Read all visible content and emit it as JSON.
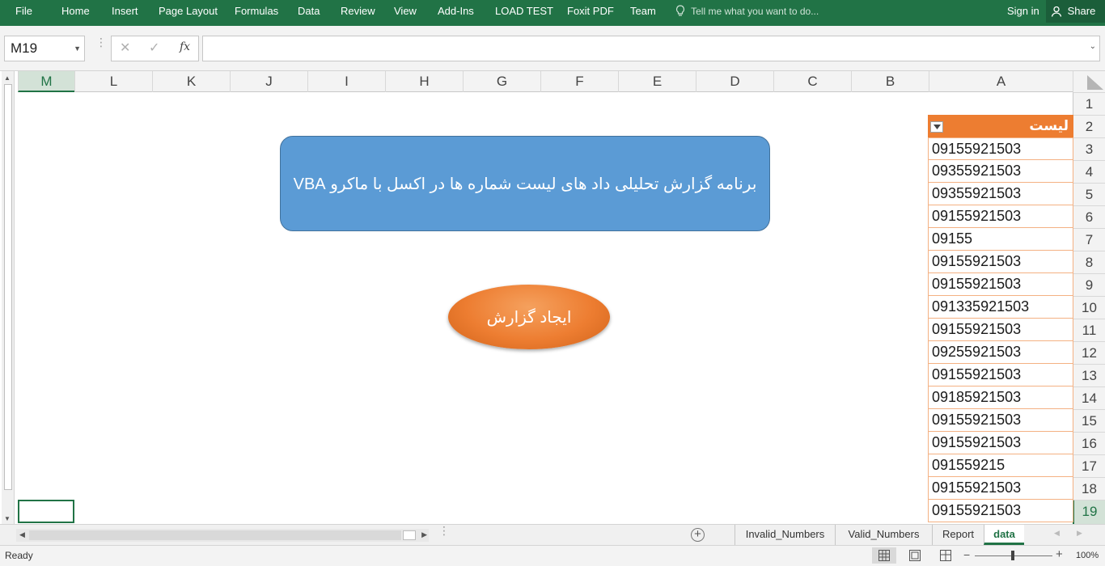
{
  "ribbon": {
    "tabs": [
      "File",
      "Home",
      "Insert",
      "Page Layout",
      "Formulas",
      "Data",
      "Review",
      "View",
      "Add-Ins",
      "LOAD TEST",
      "Foxit PDF",
      "Team"
    ],
    "tell_me": "Tell me what you want to do...",
    "sign_in": "Sign in",
    "share": "Share"
  },
  "formula_bar": {
    "name_box": "M19",
    "fx": "fx",
    "formula": ""
  },
  "grid": {
    "columns": [
      "M",
      "L",
      "K",
      "J",
      "I",
      "H",
      "G",
      "F",
      "E",
      "D",
      "C",
      "B",
      "A"
    ],
    "rows": [
      "1",
      "2",
      "3",
      "4",
      "5",
      "6",
      "7",
      "8",
      "9",
      "10",
      "11",
      "12",
      "13",
      "14",
      "15",
      "16",
      "17",
      "18",
      "19"
    ],
    "selected_cell": "M19"
  },
  "table": {
    "header": "لیست",
    "values": [
      "09155921503",
      "09355921503",
      "09355921503",
      "09155921503",
      "09155",
      "09155921503",
      "09155921503",
      "091335921503",
      "09155921503",
      "09255921503",
      "09155921503",
      "09185921503",
      "09155921503",
      "09155921503",
      "091559215",
      "09155921503",
      "09155921503"
    ],
    "header_color": "#ed7d31",
    "border_color": "#f4b183"
  },
  "shapes": {
    "title_text": "برنامه گزارش تحلیلی داد های لیست شماره ها در اکسل با ماکرو VBA",
    "title_color": "#5b9bd5",
    "button_text": "ایجاد گزارش",
    "button_color": "#ed7d31"
  },
  "sheets": {
    "tabs": [
      "Invalid_Numbers",
      "Valid_Numbers",
      "Report",
      "data"
    ],
    "active": "data"
  },
  "status": {
    "ready": "Ready",
    "zoom": "100%",
    "accent": "#217346"
  }
}
